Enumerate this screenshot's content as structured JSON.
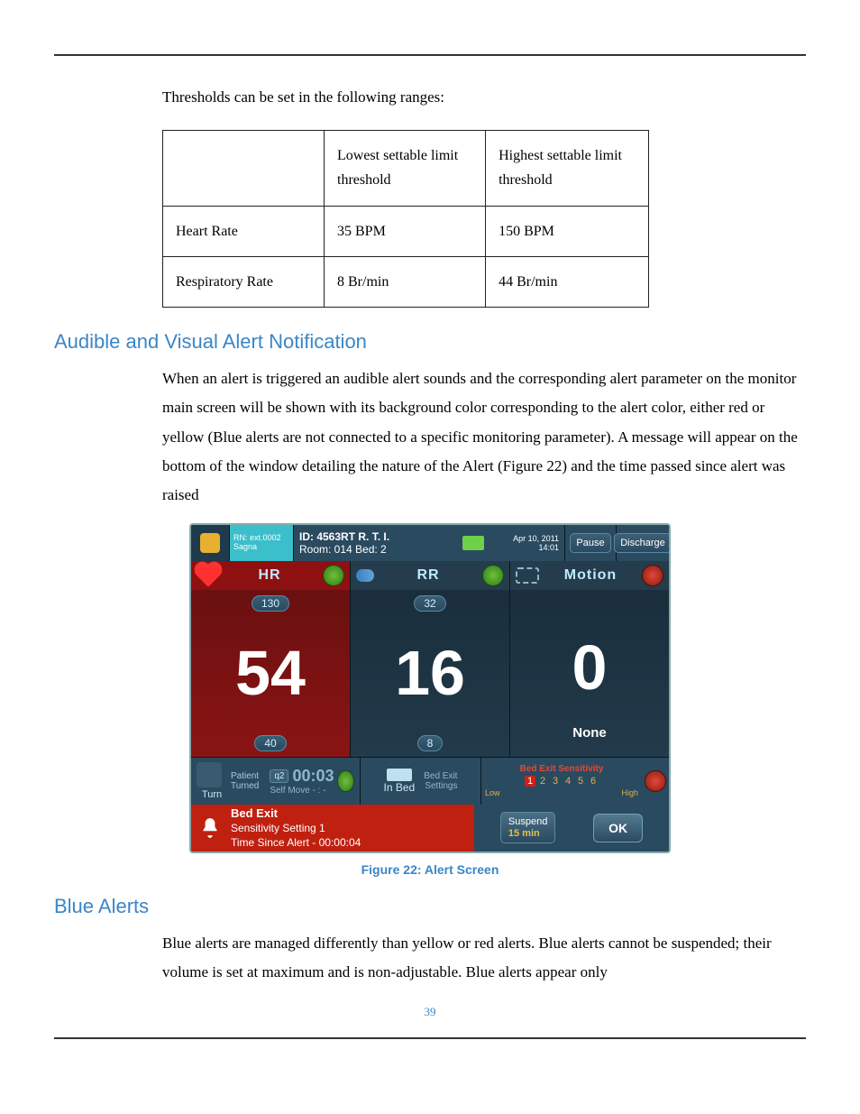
{
  "intro": "Thresholds can be set in the following ranges:",
  "table": {
    "headers": [
      "",
      "Lowest settable limit threshold",
      "Highest settable limit threshold"
    ],
    "rows": [
      [
        "Heart Rate",
        "35 BPM",
        "150 BPM"
      ],
      [
        "Respiratory Rate",
        "8 Br/min",
        "44 Br/min"
      ]
    ]
  },
  "heading1": "Audible and Visual Alert Notification",
  "para1": "When an alert is triggered an audible alert sounds and the corresponding alert parameter on the monitor main screen will be shown with its background color corresponding to the alert color, either red or yellow (Blue alerts are not connected to a specific monitoring parameter). A message will appear on the bottom of the window detailing the nature of the Alert (Figure 22) and the time passed since alert was raised",
  "figure_caption": "Figure 22: Alert Screen",
  "heading2": "Blue Alerts",
  "para2": "Blue alerts are managed differently than yellow or red alerts. Blue alerts cannot be suspended; their volume is set at maximum and is non-adjustable. Blue alerts appear only",
  "page_number": "39",
  "monitor": {
    "top": {
      "rn_line1": "RN: ext.0002",
      "rn_line2": "Sagna",
      "id": "ID: 4563RT R. T. I.",
      "room": "Room: 014 Bed: 2",
      "date": "Apr 10, 2011",
      "time": "14:01",
      "pause": "Pause",
      "discharge": "Discharge"
    },
    "headers": {
      "hr": "HR",
      "rr": "RR",
      "motion": "Motion"
    },
    "hr": {
      "upper": "130",
      "value": "54",
      "lower": "40"
    },
    "rr": {
      "upper": "32",
      "value": "16",
      "lower": "8"
    },
    "motion": {
      "value": "0",
      "status": "None"
    },
    "posture": {
      "turn_lbl": "Turn",
      "patient": "Patient",
      "turned": "Turned",
      "q": "q2",
      "timer": "00:03",
      "selfmove": "Self Move  - : -",
      "inbed": "In Bed",
      "bedexit_settings_1": "Bed Exit",
      "bedexit_settings_2": "Settings",
      "sens_title": "Bed Exit Sensitivity",
      "sens": [
        "1",
        "2",
        "3",
        "4",
        "5",
        "6"
      ],
      "sens_low": "Low",
      "sens_high": "High"
    },
    "alert": {
      "line1": "Bed Exit",
      "line2": "Sensitivity Setting 1",
      "line3": "Time Since Alert  -  00:00:04",
      "suspend": "Suspend",
      "suspend_time": "15 min",
      "ok": "OK"
    }
  }
}
